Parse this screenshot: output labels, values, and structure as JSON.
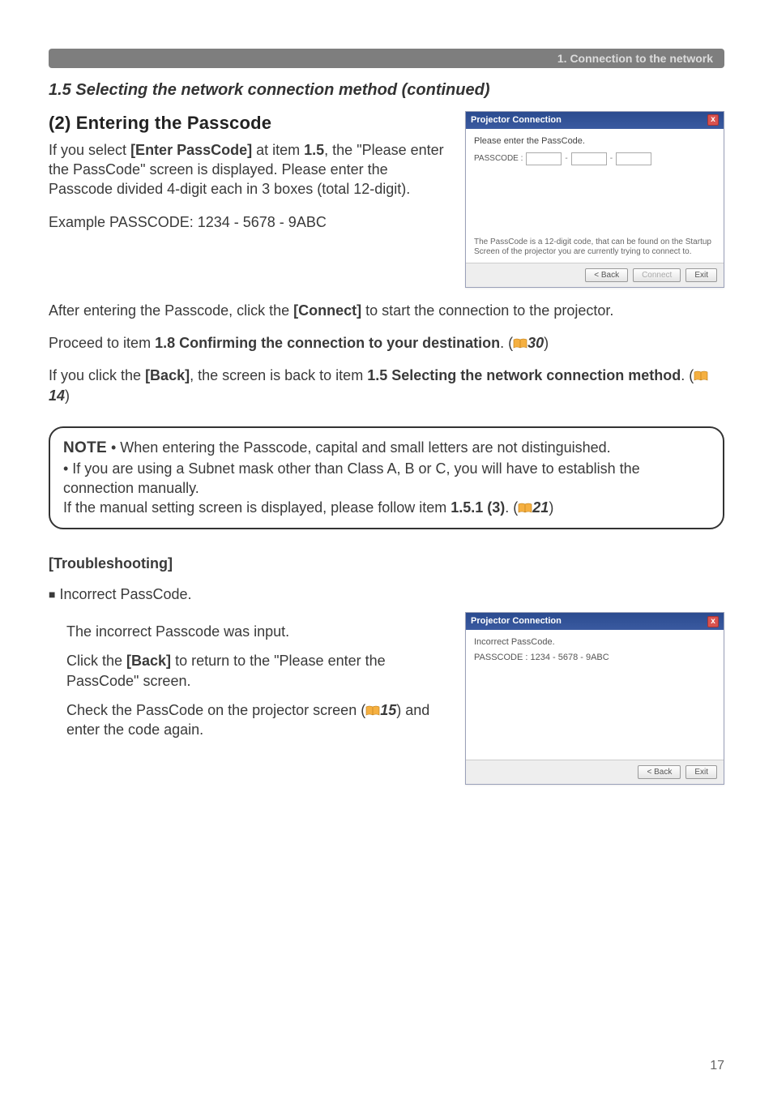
{
  "header": {
    "chapter": "1. Connection to the network"
  },
  "section_heading": "1.5 Selecting the network connection method (continued)",
  "sub_heading": "(2) Entering the Passcode",
  "dialog1": {
    "title": "Projector Connection",
    "close_label": "x",
    "prompt": "Please enter the PassCode.",
    "passcode_label": "PASSCODE :",
    "footnote": "The PassCode is a 12-digit code, that can be found on the Startup Screen of the projector you are currently trying to connect to.",
    "btn_back": "< Back",
    "btn_connect": "Connect",
    "btn_exit": "Exit"
  },
  "para1_a": "If you select ",
  "para1_b": "[Enter PassCode]",
  "para1_c": " at item ",
  "para1_d": "1.5",
  "para1_e": ", the \"Please enter the PassCode\" screen is displayed. Please enter the Passcode divided 4-digit each in 3 boxes (total 12-digit).",
  "example_line": "Example PASSCODE: 1234 - 5678 - 9ABC",
  "para2_a": "After entering the Passcode, click the ",
  "para2_b": "[Connect]",
  "para2_c": " to start the connection to the projector.",
  "para3_a": "Proceed to item ",
  "para3_b": "1.8 Confirming the connection to your destination",
  "para3_c": ". (",
  "para3_ref": "30",
  "para3_d": ")",
  "para4_a": "If you click the ",
  "para4_b": "[Back]",
  "para4_c": ", the screen is back to item ",
  "para4_d": "1.5 Selecting the network connection method",
  "para4_e": ". (",
  "para4_ref": "14",
  "para4_f": ")",
  "note": {
    "label": "NOTE",
    "line1": "  • When entering the Passcode, capital and small letters are not distinguished.",
    "line2": "• If you are using a Subnet mask other than Class A, B or C, you will have to establish the connection manually.",
    "line3_a": "If the manual setting screen is displayed, please follow item ",
    "line3_b": "1.5.1 (3)",
    "line3_c": ". (",
    "line3_ref": "21",
    "line3_d": ")"
  },
  "troubleshoot": {
    "heading": "[Troubleshooting]",
    "bullet": "Incorrect PassCode.",
    "p1": "The incorrect Passcode was input.",
    "p2_a": "Click the ",
    "p2_b": "[Back]",
    "p2_c": " to return to the \"Please enter the PassCode\" screen.",
    "p3_a": "Check the PassCode on the projector screen (",
    "p3_ref": "15",
    "p3_b": ") and enter the code again."
  },
  "dialog2": {
    "title": "Projector Connection",
    "close_label": "x",
    "line1": "Incorrect PassCode.",
    "line2": "PASSCODE : 1234 - 5678 - 9ABC",
    "btn_back": "< Back",
    "btn_exit": "Exit"
  },
  "page_number": "17"
}
